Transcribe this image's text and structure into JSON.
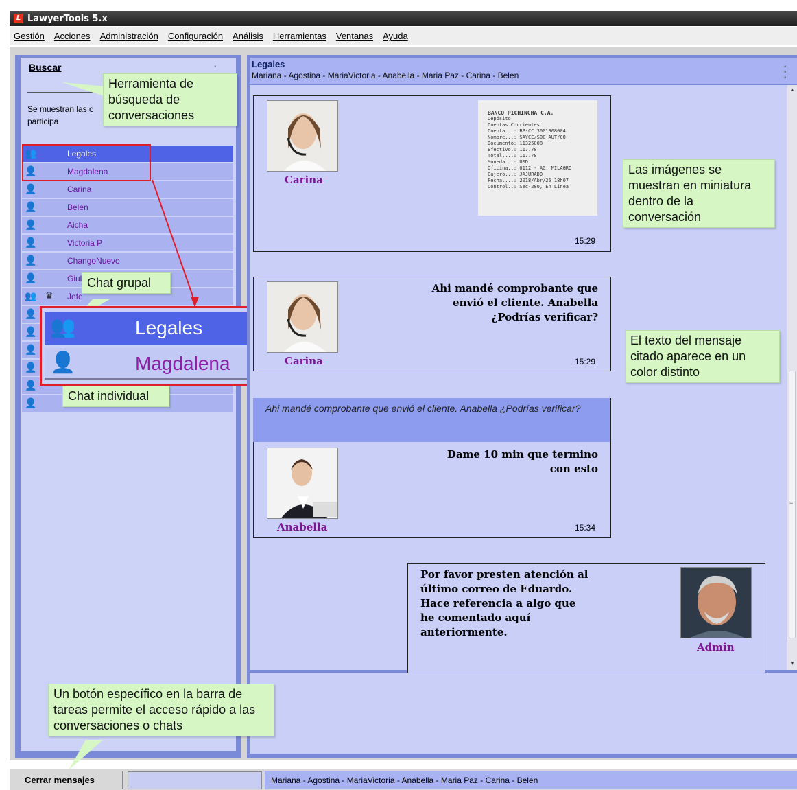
{
  "window": {
    "title": "LawyerTools 5.x"
  },
  "menu": [
    "Gestión",
    "Acciones",
    "Administración",
    "Configuración",
    "Análisis",
    "Herramientas",
    "Ventanas",
    "Ayuda"
  ],
  "left_panel": {
    "search_title": "Buscar",
    "search_desc": "Se muestran las c participa",
    "users": [
      {
        "name": "Legales",
        "type": "group"
      },
      {
        "name": "Magdalena",
        "type": "individual"
      },
      {
        "name": "Carina",
        "type": "individual"
      },
      {
        "name": "Belen",
        "type": "individual"
      },
      {
        "name": "Aicha",
        "type": "individual"
      },
      {
        "name": "Victoria P",
        "type": "individual"
      },
      {
        "name": "ChangoNuevo",
        "type": "individual"
      },
      {
        "name": "Giul",
        "type": "individual"
      },
      {
        "name": "Jefe",
        "type": "group"
      },
      {
        "name": "",
        "type": "individual"
      },
      {
        "name": "",
        "type": "individual"
      },
      {
        "name": "",
        "type": "individual"
      },
      {
        "name": "",
        "type": "individual"
      },
      {
        "name": "",
        "type": "individual"
      },
      {
        "name": "",
        "type": "individual"
      }
    ],
    "zoom": {
      "group_name": "Legales",
      "individual_name": "Magdalena"
    }
  },
  "callouts": {
    "search_tool": "Herramienta de búsqueda de conversaciones",
    "group_chat": "Chat grupal",
    "individual_chat": "Chat individual",
    "thumbnails": "Las imágenes se muestran en miniatura dentro de la conversación",
    "quoted_text": "El texto del mensaje citado aparece en un color distinto",
    "taskbar": "Un botón específico en la barra de tareas permite el acceso rápido a las conversaciones o chats"
  },
  "chat": {
    "title": "Legales",
    "members": "Mariana - Agostina - MariaVictoria - Anabella - Maria Paz - Carina - Belen",
    "messages": [
      {
        "author": "Carina",
        "text": "",
        "time": "15:29",
        "has_image": true
      },
      {
        "author": "Carina",
        "text": "Ahi mandé comprobante que envió el cliente. Anabella ¿Podrías verificar?",
        "time": "15:29"
      },
      {
        "author": "Anabella",
        "quote": "Ahi mandé comprobante que envió el cliente. Anabella ¿Podrías verificar?",
        "text": "Dame 10 min que termino con esto",
        "time": "15:34"
      },
      {
        "author": "Admin",
        "text": "Por favor presten atención al último correo de Eduardo. Hace referencia a algo que he comentado aquí anteriormente.",
        "time": ""
      }
    ],
    "receipt_lines": [
      "BANCO PICHINCHA C.A.",
      "Depósito",
      "Cuentas Corrientes",
      "Cuenta...: BP-CC 3001308004",
      "Nombre...: SAYCE/SOC AUT/CO",
      "Documento: 11325008",
      "Efectivo.: 117.78",
      "Total....: 117.78",
      "Moneda...: USD",
      "Oficina..: 0112 - AG. MILAGRO",
      "Cajero...: JAJURADO",
      "Fecha....: 2018/Abr/25 18h07",
      "Control..: Sec-280, En Línea"
    ]
  },
  "statusbar": {
    "close_button": "Cerrar mensajes",
    "members": "Mariana - Agostina - MariaVictoria - Anabella - Maria Paz - Carina - Belen"
  }
}
